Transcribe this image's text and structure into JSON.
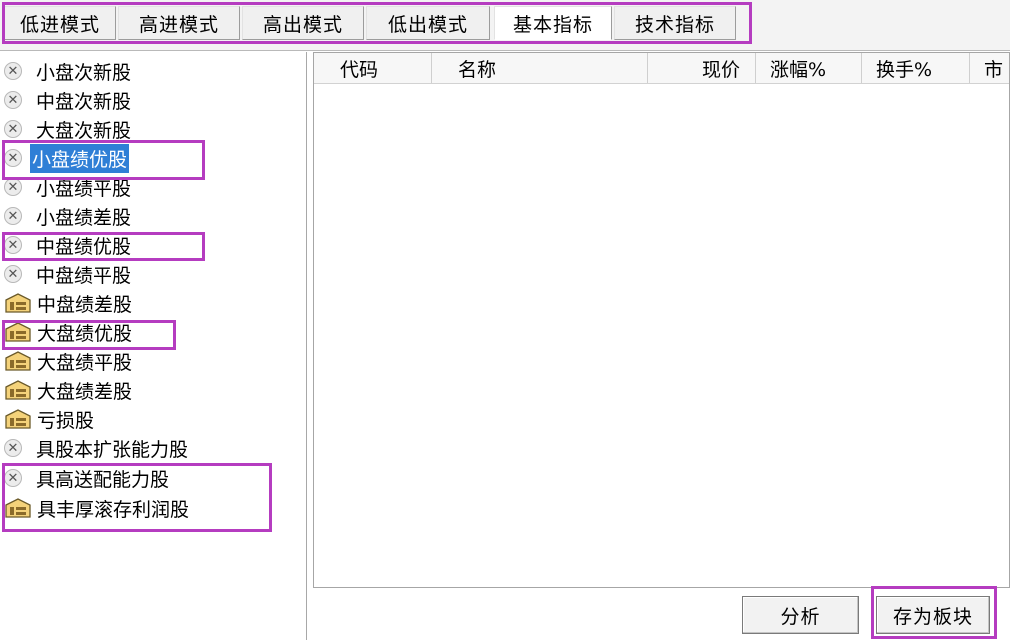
{
  "tabs": [
    {
      "label": "低进模式",
      "active": false
    },
    {
      "label": "高进模式",
      "active": false
    },
    {
      "label": "高出模式",
      "active": false
    },
    {
      "label": "低出模式",
      "active": false
    },
    {
      "label": "基本指标",
      "active": true
    },
    {
      "label": "技术指标",
      "active": false
    }
  ],
  "list": {
    "items": [
      {
        "label": "小盘次新股",
        "icon": "circle-x-icon"
      },
      {
        "label": "中盘次新股",
        "icon": "circle-x-icon"
      },
      {
        "label": "大盘次新股",
        "icon": "circle-x-icon"
      },
      {
        "label": "小盘绩优股",
        "icon": "circle-x-icon",
        "selected": true
      },
      {
        "label": "小盘绩平股",
        "icon": "circle-x-icon"
      },
      {
        "label": "小盘绩差股",
        "icon": "circle-x-icon"
      },
      {
        "label": "中盘绩优股",
        "icon": "circle-x-icon"
      },
      {
        "label": "中盘绩平股",
        "icon": "circle-x-icon"
      },
      {
        "label": "中盘绩差股",
        "icon": "folder-key-icon"
      },
      {
        "label": "大盘绩优股",
        "icon": "folder-key-icon"
      },
      {
        "label": "大盘绩平股",
        "icon": "folder-key-icon"
      },
      {
        "label": "大盘绩差股",
        "icon": "folder-key-icon"
      },
      {
        "label": "亏损股",
        "icon": "folder-key-icon"
      },
      {
        "label": "具股本扩张能力股",
        "icon": "circle-x-icon"
      },
      {
        "label": "具高送配能力股",
        "icon": "circle-x-icon"
      },
      {
        "label": "具丰厚滚存利润股",
        "icon": "folder-key-icon"
      }
    ]
  },
  "table": {
    "columns": [
      "代码",
      "名称",
      "现价",
      "涨幅%",
      "换手%",
      "市"
    ]
  },
  "buttons": {
    "analyze": "分析",
    "save_block": "存为板块"
  },
  "colors": {
    "highlight": "#b53cc0",
    "selection": "#2f7fd6"
  }
}
